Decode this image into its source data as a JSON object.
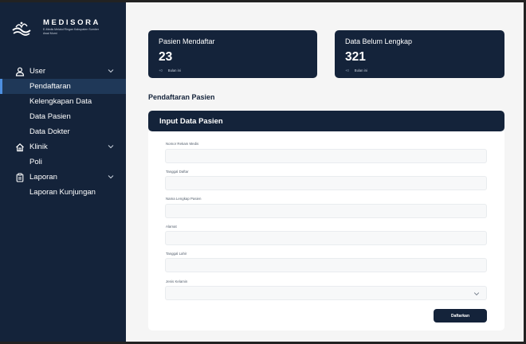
{
  "brand": {
    "name": "MEDISORA",
    "tagline": "E-Medis Melalui Ringan Kabupaten Sumber Awal Murni"
  },
  "sidebar": {
    "groups": [
      {
        "label": "User",
        "icon": "user-icon",
        "items": [
          "Pendaftaran",
          "Kelengkapan Data",
          "Data Pasien",
          "Data Dokter"
        ]
      },
      {
        "label": "Klinik",
        "icon": "home-icon",
        "items": [
          "Poli"
        ]
      },
      {
        "label": "Laporan",
        "icon": "clipboard-icon",
        "items": [
          "Laporan Kunjungan"
        ]
      }
    ],
    "active_item": "Pendaftaran"
  },
  "stats": [
    {
      "title": "Pasien Mendaftar",
      "value": "23",
      "delta": "+0",
      "period": "Bulan ini"
    },
    {
      "title": "Data Belum Lengkap",
      "value": "321",
      "delta": "+0",
      "period": "Bulan ini"
    }
  ],
  "section_title": "Pendaftaran Pasien",
  "form": {
    "header": "Input Data Pasien",
    "fields": [
      {
        "label": "Nomor Rekam Medis",
        "value": ""
      },
      {
        "label": "Tanggal Daftar",
        "value": ""
      },
      {
        "label": "Nama Lengkap Pasien",
        "value": ""
      },
      {
        "label": "Alamat",
        "value": ""
      },
      {
        "label": "Tanggal Lahir",
        "value": ""
      },
      {
        "label": "Jenis Kelamin",
        "value": ""
      }
    ],
    "submit_label": "Daftarkan"
  },
  "colors": {
    "navy": "#14233a",
    "active_bg": "#1f3858",
    "active_accent": "#4d8fe0",
    "page_bg": "#f5f5f5"
  }
}
